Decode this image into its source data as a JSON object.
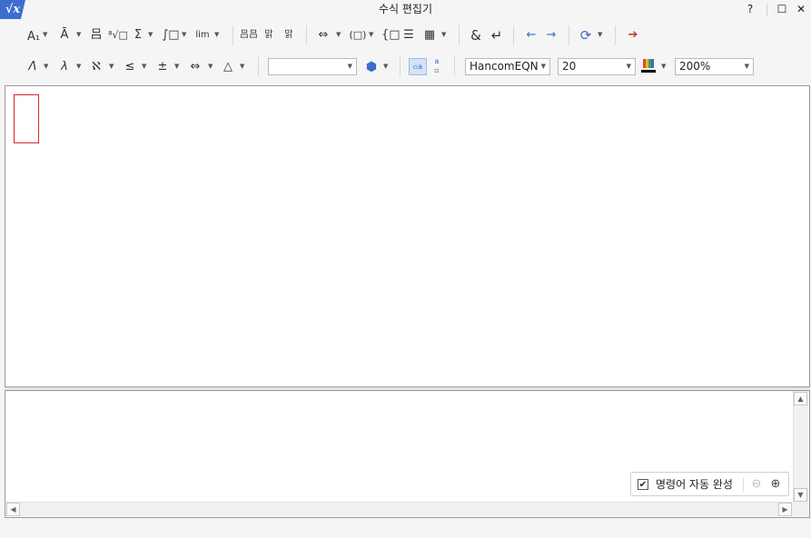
{
  "window": {
    "title": "수식 편집기",
    "app_icon_glyph": "√x",
    "help": "?",
    "maximize": "☐",
    "close": "✕"
  },
  "toolbar1": {
    "style": "A₁",
    "decoration": "Ā",
    "fraction": "吕",
    "root": "⁸√□",
    "sum": "Σ",
    "integral": "∫□",
    "limit": "lim",
    "matrix1": "吕吕",
    "matrix2": "맑",
    "matrix3": "맑",
    "spacing": "⇔",
    "paren": "(□)",
    "brace": "{□",
    "align_rows": "☰",
    "grid": "▦",
    "ampersand": "&",
    "newline": "↵",
    "prev": "←",
    "next": "→",
    "history": "⟳",
    "exit": "➔"
  },
  "toolbar2": {
    "greek_upper": "Λ",
    "greek_lower": "λ",
    "hebrew": "ℵ",
    "relation": "≤",
    "plusminus": "±",
    "arrow": "⇔",
    "misc": "△",
    "font_value": "HancomEQN",
    "size_value": "20",
    "zoom_value": "200%",
    "text_color": "#000000"
  },
  "script_pane": {
    "autocomplete_label": "명령어 자동 완성",
    "autocomplete_checked": true
  },
  "colors": {
    "accent": "#3b6ed0",
    "cursor_box": "#d9262b"
  }
}
